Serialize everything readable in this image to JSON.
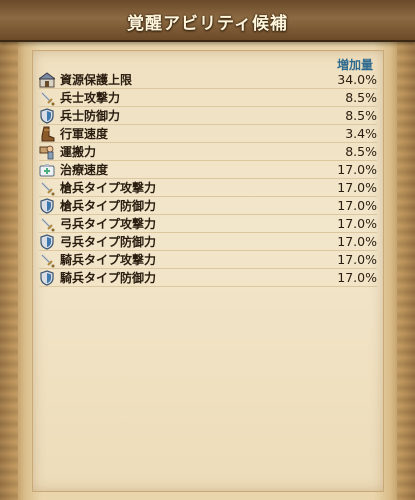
{
  "header": {
    "title": "覚醒アビリティ候補"
  },
  "table": {
    "column_header": "増加量",
    "rows": [
      {
        "icon": "warehouse-icon",
        "label": "資源保護上限",
        "value": "34.0%"
      },
      {
        "icon": "sword-icon",
        "label": "兵士攻撃力",
        "value": "8.5%"
      },
      {
        "icon": "shield-icon",
        "label": "兵士防御力",
        "value": "8.5%"
      },
      {
        "icon": "boot-icon",
        "label": "行軍速度",
        "value": "3.4%"
      },
      {
        "icon": "porter-icon",
        "label": "運搬力",
        "value": "8.5%"
      },
      {
        "icon": "medical-kit-icon",
        "label": "治療速度",
        "value": "17.0%"
      },
      {
        "icon": "sword-icon",
        "label": "槍兵タイプ攻撃力",
        "value": "17.0%"
      },
      {
        "icon": "shield-icon",
        "label": "槍兵タイプ防御力",
        "value": "17.0%"
      },
      {
        "icon": "sword-icon",
        "label": "弓兵タイプ攻撃力",
        "value": "17.0%"
      },
      {
        "icon": "shield-icon",
        "label": "弓兵タイプ防御力",
        "value": "17.0%"
      },
      {
        "icon": "sword-icon",
        "label": "騎兵タイプ攻撃力",
        "value": "17.0%"
      },
      {
        "icon": "shield-icon",
        "label": "騎兵タイプ防御力",
        "value": "17.0%"
      }
    ]
  }
}
